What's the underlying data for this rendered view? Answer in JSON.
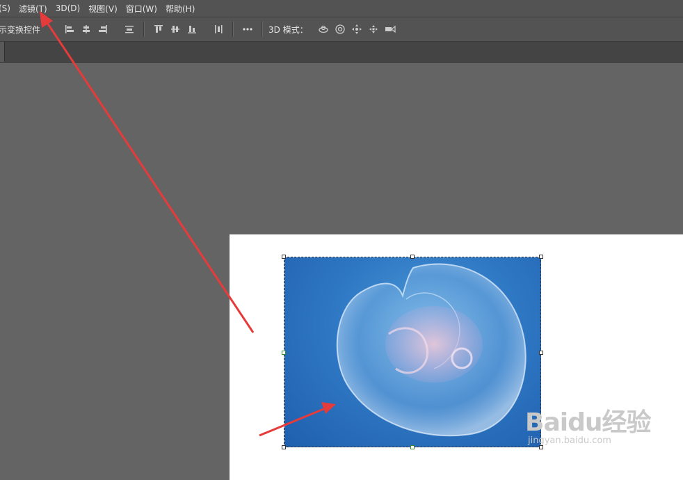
{
  "menubar": {
    "items": [
      "(S)",
      "滤镜(T)",
      "3D(D)",
      "视图(V)",
      "窗口(W)",
      "帮助(H)"
    ]
  },
  "options_bar": {
    "transform_label": "示变换控件",
    "mode_label": "3D 模式：",
    "icons": [
      "align-left-icon",
      "align-center-h-icon",
      "align-right-icon",
      "distribute-h-icon",
      "align-top-icon",
      "align-middle-v-icon",
      "align-bottom-icon",
      "distribute-v-icon",
      "more-icon",
      "orbit-icon",
      "roll-icon",
      "pan-icon",
      "slide-icon",
      "camera-scale-icon"
    ]
  },
  "document": {
    "background": "#ffffff",
    "image_subject": "jellyfish"
  },
  "watermark": {
    "logo": "Baidu经验",
    "url": "jingyan.baidu.com"
  },
  "colors": {
    "workspace": "#646464",
    "panel": "#535353",
    "arrow": "#e63b3b"
  }
}
